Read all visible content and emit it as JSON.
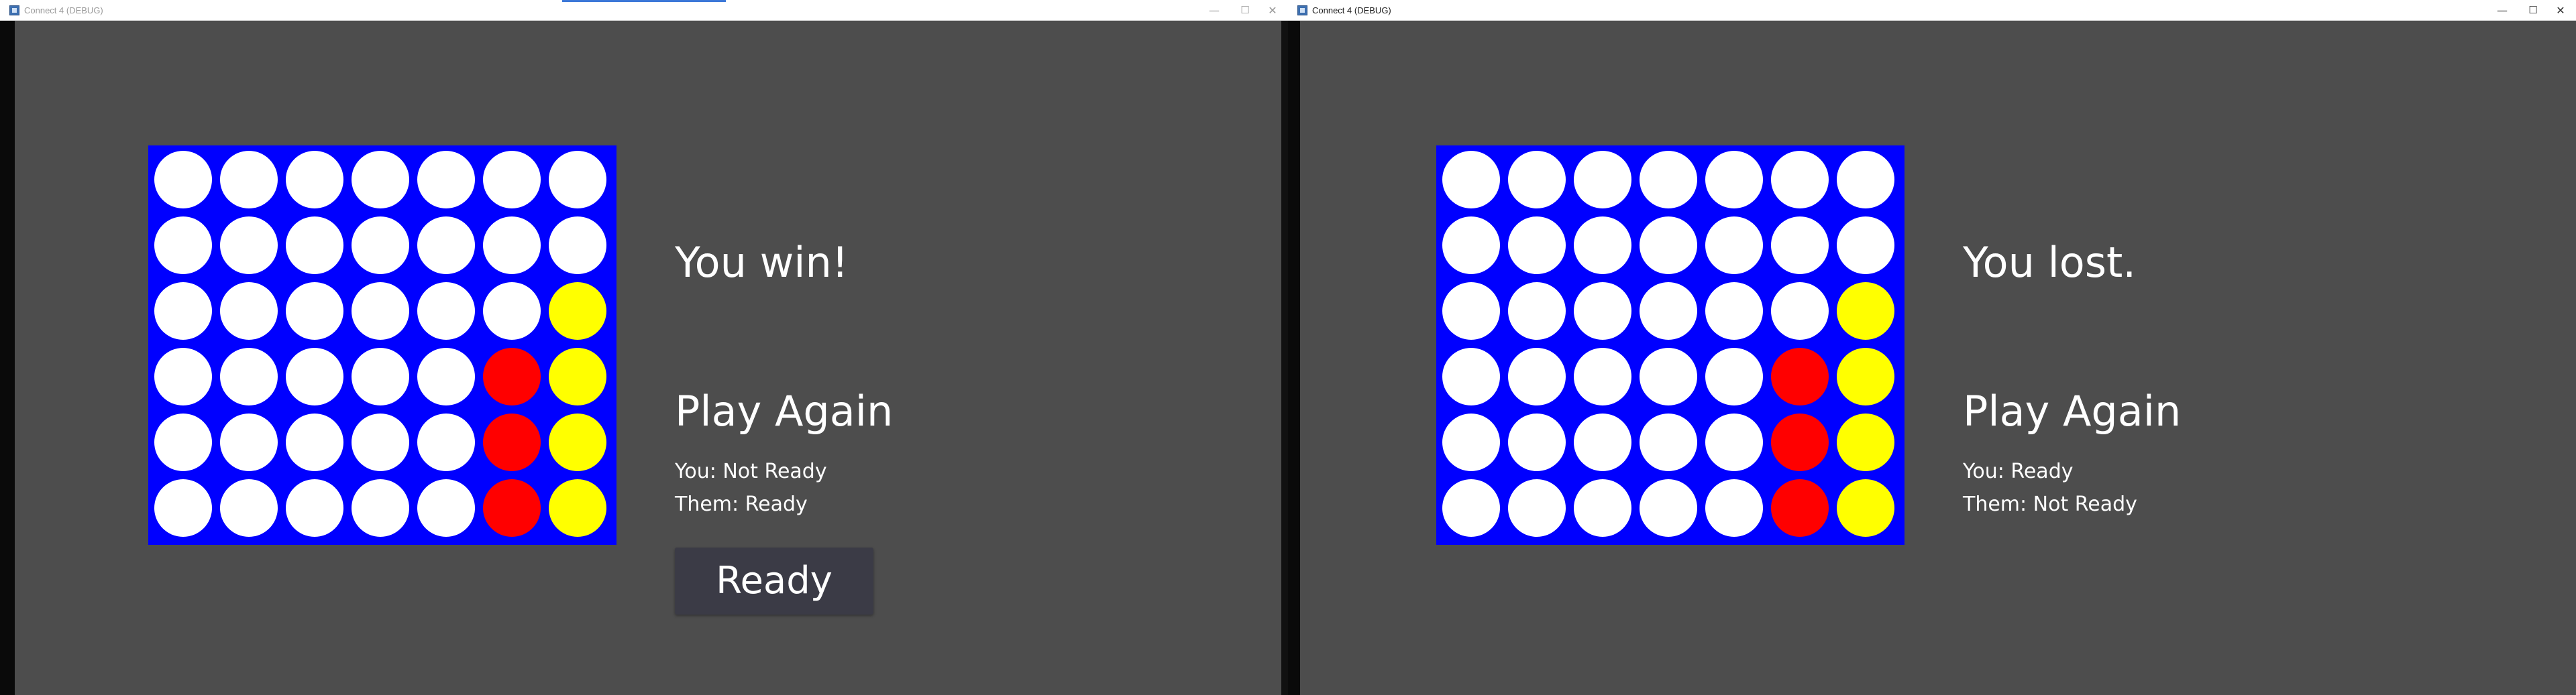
{
  "colors": {
    "background": "#4d4d4d",
    "board": "#0000ff",
    "empty": "#ffffff",
    "red": "#ff0000",
    "yellow": "#ffff00",
    "ready_button": "#3b3b46"
  },
  "windows": [
    {
      "title": "Connect 4 (DEBUG)",
      "controls": {
        "minimize": "—",
        "maximize": "☐",
        "close": "✕"
      },
      "status": "You win!",
      "play_again": "Play Again",
      "you_status": "You: Not Ready",
      "them_status": "Them: Ready",
      "ready_button": "Ready",
      "board": [
        [
          "empty",
          "empty",
          "empty",
          "empty",
          "empty",
          "empty",
          "empty"
        ],
        [
          "empty",
          "empty",
          "empty",
          "empty",
          "empty",
          "empty",
          "empty"
        ],
        [
          "empty",
          "empty",
          "empty",
          "empty",
          "empty",
          "empty",
          "yellow"
        ],
        [
          "empty",
          "empty",
          "empty",
          "empty",
          "empty",
          "red",
          "yellow"
        ],
        [
          "empty",
          "empty",
          "empty",
          "empty",
          "empty",
          "red",
          "yellow"
        ],
        [
          "empty",
          "empty",
          "empty",
          "empty",
          "empty",
          "red",
          "yellow"
        ]
      ]
    },
    {
      "title": "Connect 4 (DEBUG)",
      "controls": {
        "minimize": "—",
        "maximize": "☐",
        "close": "✕"
      },
      "status": "You lost.",
      "play_again": "Play Again",
      "you_status": "You: Ready",
      "them_status": "Them: Not Ready",
      "board": [
        [
          "empty",
          "empty",
          "empty",
          "empty",
          "empty",
          "empty",
          "empty"
        ],
        [
          "empty",
          "empty",
          "empty",
          "empty",
          "empty",
          "empty",
          "empty"
        ],
        [
          "empty",
          "empty",
          "empty",
          "empty",
          "empty",
          "empty",
          "yellow"
        ],
        [
          "empty",
          "empty",
          "empty",
          "empty",
          "empty",
          "red",
          "yellow"
        ],
        [
          "empty",
          "empty",
          "empty",
          "empty",
          "empty",
          "red",
          "yellow"
        ],
        [
          "empty",
          "empty",
          "empty",
          "empty",
          "empty",
          "red",
          "yellow"
        ]
      ]
    }
  ]
}
